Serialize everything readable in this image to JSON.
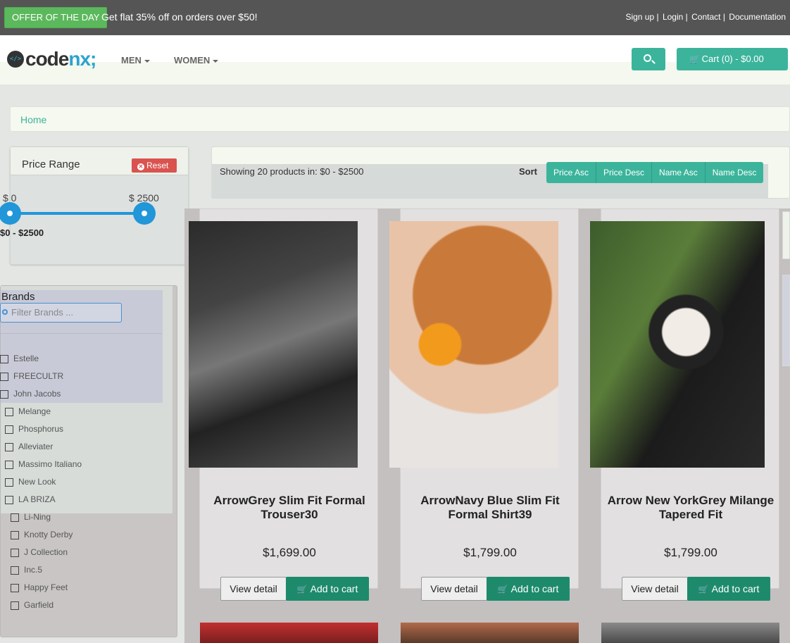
{
  "topbar": {
    "offer_label": "OFFER OF THE DAY",
    "offer_text": "Get flat 35% off on orders over $50!",
    "links": [
      "Sign up",
      "Login",
      "Contact",
      "Documentation"
    ]
  },
  "header": {
    "logo_text_main": "code",
    "logo_text_accent": "nx;",
    "logo_glyph": "</>",
    "nav": [
      {
        "label": "MEN"
      },
      {
        "label": "WOMEN"
      }
    ],
    "cart_label": "Cart (0) - $0.00"
  },
  "breadcrumb": {
    "home": "Home"
  },
  "price_range": {
    "title": "Price Range",
    "reset_label": "Reset",
    "min_label": "$ 0",
    "max_label": "$ 2500",
    "range_text": "$0  -  $2500"
  },
  "brands": {
    "title": "Brands",
    "search_placeholder": "Filter Brands ...",
    "items": [
      "Estelle",
      "FREECULTR",
      "John Jacobs",
      "Melange",
      "Phosphorus",
      "Alleviater",
      "Massimo Italiano",
      "New Look",
      "LA BRIZA",
      "Li-Ning",
      "Knotty Derby",
      "J Collection",
      "Inc.5",
      "Happy Feet",
      "Garfield"
    ]
  },
  "toolbar": {
    "showing_text": "Showing 20 products in: $0 - $2500",
    "sort_label": "Sort",
    "sort_options": [
      "Price Asc",
      "Price Desc",
      "Name Asc",
      "Name Desc"
    ]
  },
  "products": [
    {
      "name": "ArrowGrey Slim Fit Formal Trouser30",
      "price": "$1,699.00"
    },
    {
      "name": "ArrowNavy Blue Slim Fit Formal Shirt39",
      "price": "$1,799.00"
    },
    {
      "name": "Arrow New YorkGrey Milange Tapered Fit",
      "price": "$1,799.00"
    }
  ],
  "product_buttons": {
    "view_label": "View detail",
    "cart_label": "Add to cart"
  },
  "colors": {
    "accent": "#3cb49c",
    "offer": "#5cb85c",
    "reset": "#d9534f",
    "slider": "#2196d8",
    "add_to_cart": "#1e8a6c"
  },
  "icons": [
    "search-icon",
    "cart-icon",
    "close-icon",
    "chevron-down-icon",
    "checkbox-icon"
  ]
}
